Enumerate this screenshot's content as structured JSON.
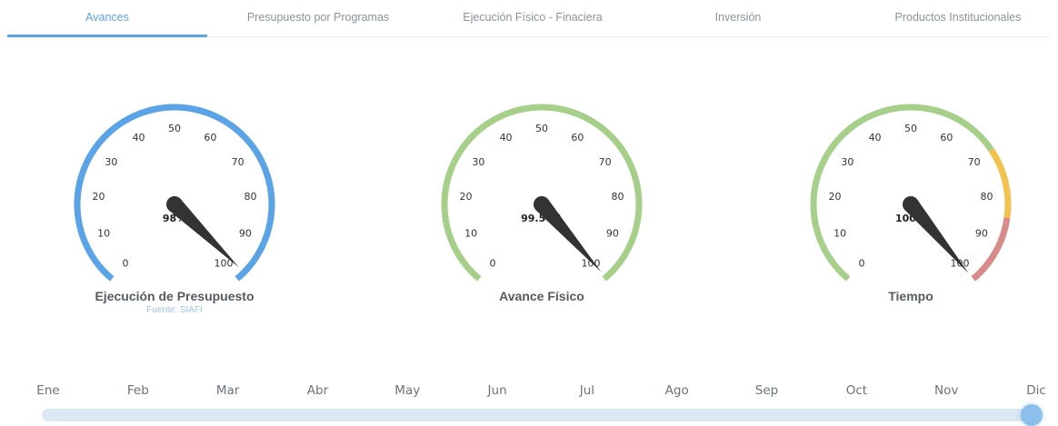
{
  "tabs": [
    {
      "label": "Avances",
      "active": true
    },
    {
      "label": "Presupuesto por Programas",
      "active": false
    },
    {
      "label": "Ejecución Físico - Finaciera",
      "active": false
    },
    {
      "label": "Inversión",
      "active": false
    },
    {
      "label": "Productos Institucionales",
      "active": false
    }
  ],
  "colors": {
    "accent": "#5aa3e6",
    "gauge_blue": "#5aa3e6",
    "gauge_green": "#a6cf8a",
    "gauge_yellow": "#f2c14e",
    "gauge_red": "#d98a8a",
    "needle": "#333333"
  },
  "gauges": [
    {
      "title": "Ejecución de Presupuesto",
      "subtitle": "Fuente: SIAFI",
      "value": 98,
      "value_label": "98%",
      "ticks": [
        "0",
        "10",
        "20",
        "30",
        "40",
        "50",
        "60",
        "70",
        "80",
        "90",
        "100"
      ],
      "bands": [
        {
          "from": 0,
          "to": 100,
          "color": "#5aa3e6"
        }
      ]
    },
    {
      "title": "Avance Físico",
      "subtitle": "",
      "value": 99.54,
      "value_label": "99.54%",
      "ticks": [
        "0",
        "10",
        "20",
        "30",
        "40",
        "50",
        "60",
        "70",
        "80",
        "90",
        "100"
      ],
      "bands": [
        {
          "from": 0,
          "to": 100,
          "color": "#a6cf8a"
        }
      ]
    },
    {
      "title": "Tiempo",
      "subtitle": "",
      "value": 100,
      "value_label": "100%",
      "ticks": [
        "0",
        "10",
        "20",
        "30",
        "40",
        "50",
        "60",
        "70",
        "80",
        "90",
        "100"
      ],
      "bands": [
        {
          "from": 0,
          "to": 70,
          "color": "#a6cf8a"
        },
        {
          "from": 70,
          "to": 85,
          "color": "#f2c14e"
        },
        {
          "from": 85,
          "to": 100,
          "color": "#d98a8a"
        }
      ]
    }
  ],
  "timeline": {
    "months": [
      "Ene",
      "Feb",
      "Mar",
      "Abr",
      "May",
      "Jun",
      "Jul",
      "Ago",
      "Sep",
      "Oct",
      "Nov",
      "Dic"
    ],
    "selected_index": 11
  }
}
